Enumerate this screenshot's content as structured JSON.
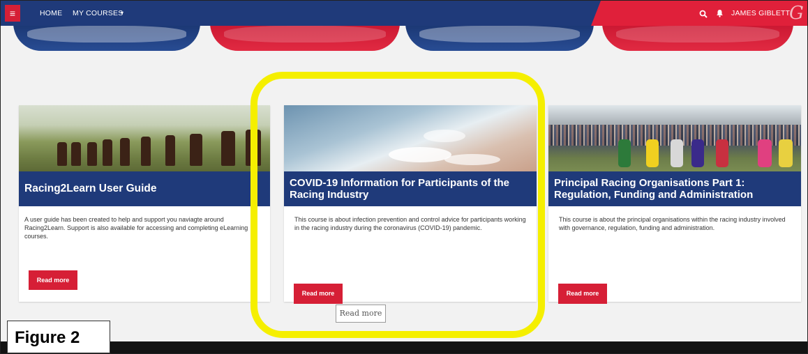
{
  "nav": {
    "menu_icon": "hamburger-icon",
    "menu_glyph": "≡",
    "home": "HOME",
    "my_courses": "MY COURSES",
    "caret": "▾",
    "search_glyph": "⚲",
    "bell_glyph": "🔔",
    "user": "JAMES GIBLETT",
    "logo_glyph": "G"
  },
  "cards": [
    {
      "title": "Racing2Learn User Guide",
      "description": "A user guide has been created to help and support you naviagte around Racing2Learn. Support is also available for accessing and completing eLearning courses.",
      "button": "Read more"
    },
    {
      "title": "COVID-19 Information for Participants of the Racing Industry",
      "description": "This course is about infection prevention and control advice for participants working in the racing industry during the coronavirus (COVID-19) pandemic.",
      "button": "Read more"
    },
    {
      "title": "Principal Racing Organisations Part 1: Regulation, Funding and Administration",
      "description": "This course is about the principal organisations within the racing industry involved with governance, regulation, funding and administration.",
      "button": "Read more"
    }
  ],
  "tooltip": "Read more",
  "figure_label": "Figure 2",
  "colors": {
    "nav_blue": "#1f3a7a",
    "brand_red": "#d61f36",
    "highlight": "#f5ef00"
  }
}
